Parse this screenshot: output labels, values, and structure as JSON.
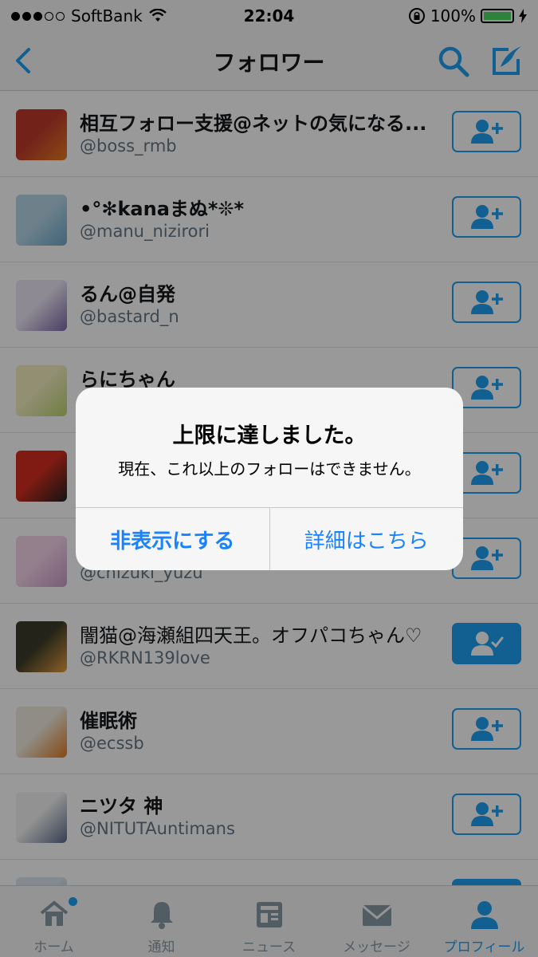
{
  "status_bar": {
    "carrier": "SoftBank",
    "time": "22:04",
    "battery": "100%"
  },
  "nav": {
    "title": "フォロワー",
    "back_icon": "chevron-left-icon",
    "search_icon": "search-icon",
    "compose_icon": "compose-icon"
  },
  "rows": [
    {
      "name": "相互フォロー支援@ネットの気になる...",
      "handle": "@boss_rmb",
      "following": false,
      "bold": true
    },
    {
      "name": "•°✻kanaまぬ*❊*",
      "handle": "@manu_nizirori",
      "following": false,
      "bold": true
    },
    {
      "name": "るん@自発",
      "handle": "@bastard_n",
      "following": false,
      "bold": true
    },
    {
      "name": "らにちゃん",
      "handle": "",
      "following": false,
      "bold": true
    },
    {
      "name": "",
      "handle": "",
      "following": false,
      "bold": true
    },
    {
      "name": "",
      "handle": "@chizuki_yuzu",
      "following": false,
      "bold": true
    },
    {
      "name": "闇猫@海瀬組四天王。オフパコちゃん♡",
      "handle": "@RKRN139love",
      "following": true,
      "bold": false
    },
    {
      "name": "催眠術",
      "handle": "@ecssb",
      "following": false,
      "bold": true
    },
    {
      "name": "ニツタ 神",
      "handle": "@NITUTAuntimans",
      "following": false,
      "bold": true
    },
    {
      "name": "",
      "handle": "",
      "following": true,
      "bold": true
    }
  ],
  "tabs": [
    {
      "label": "ホーム",
      "icon": "home-icon",
      "active": false
    },
    {
      "label": "通知",
      "icon": "bell-icon",
      "active": false
    },
    {
      "label": "ニュース",
      "icon": "news-icon",
      "active": false
    },
    {
      "label": "メッセージ",
      "icon": "envelope-icon",
      "active": false
    },
    {
      "label": "プロフィール",
      "icon": "person-icon",
      "active": true
    }
  ],
  "alert": {
    "title": "上限に達しました。",
    "message": "現在、これ以上のフォローはできません。",
    "dismiss_label": "非表示にする",
    "details_label": "詳細はこちら"
  },
  "colors": {
    "accent": "#1da1f2",
    "alert_link": "#1a82ff"
  }
}
